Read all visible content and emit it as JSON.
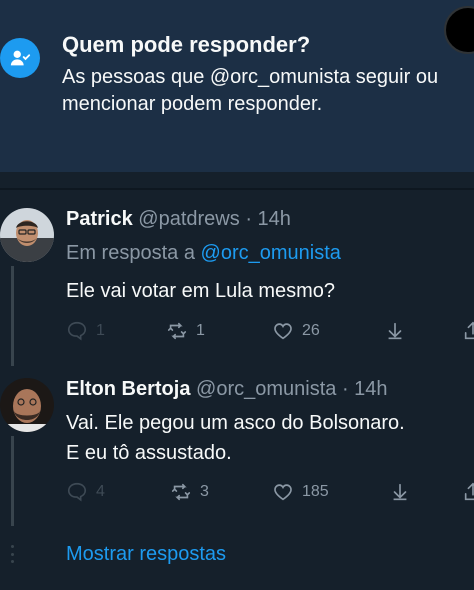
{
  "banner": {
    "title": "Quem pode responder?",
    "text": "As pessoas que @orc_omunista seguir ou mencionar podem responder."
  },
  "tweets": [
    {
      "name": "Patrick",
      "handle": "@patdrews",
      "time": "· 14h",
      "reply_prefix": "Em resposta a",
      "reply_handle": "@orc_omunista",
      "text": "Ele vai votar em Lula mesmo?",
      "replies": "1",
      "retweets": "1",
      "likes": "26"
    },
    {
      "name": "Elton Bertoja",
      "handle": "@orc_omunista",
      "time": "· 14h",
      "text_line1": "Vai. Ele pegou um asco do Bolsonaro.",
      "text_line2": "E eu tô assustado.",
      "replies": "4",
      "retweets": "3",
      "likes": "185"
    }
  ],
  "show_replies_label": "Mostrar respostas",
  "colors": {
    "background": "#15202b",
    "banner": "#1c2f45",
    "accent": "#1d9bf0",
    "muted": "#8b98a5"
  }
}
